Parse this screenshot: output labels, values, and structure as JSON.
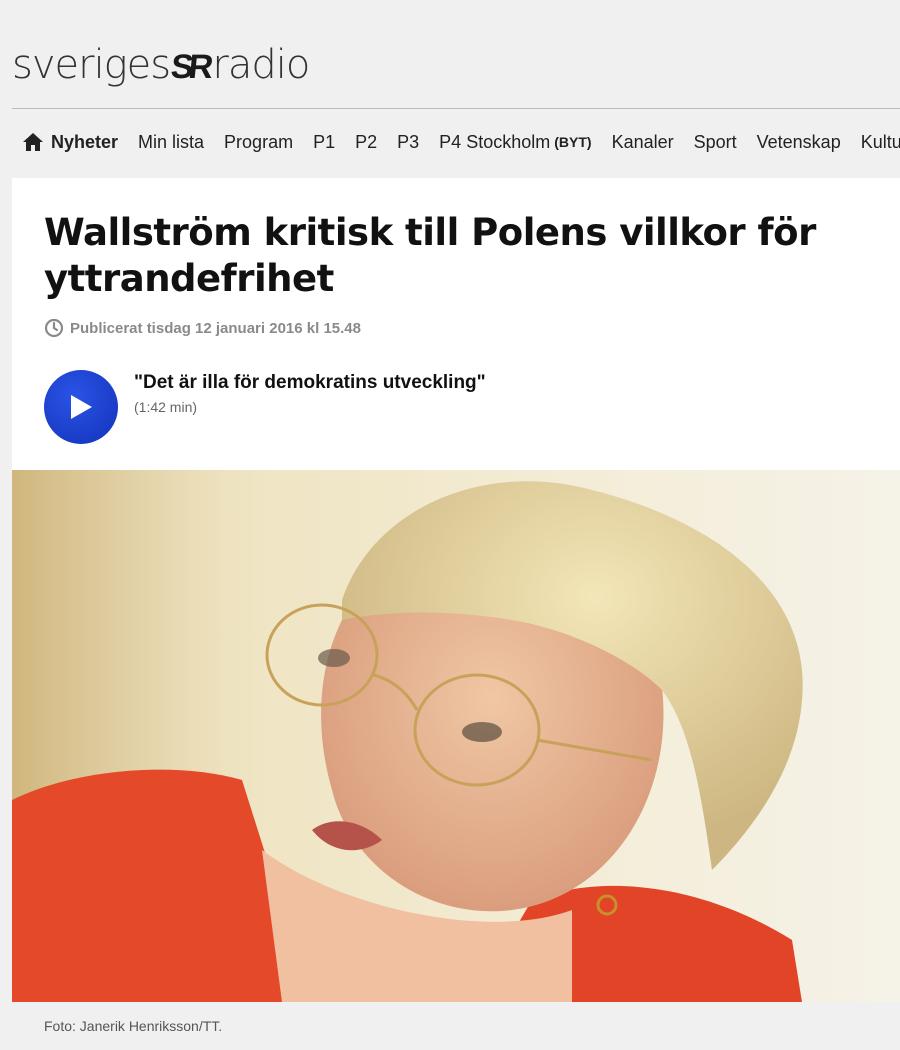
{
  "brand": {
    "logo_left": "sveriges",
    "logo_mark": "SR",
    "logo_right": "radio"
  },
  "nav": {
    "items": [
      "Nyheter",
      "Min lista",
      "Program",
      "P1",
      "P2",
      "P3",
      "P4 Stockholm",
      "Kanaler",
      "Sport",
      "Vetenskap",
      "Kultur"
    ],
    "p4_change": "(BYT)",
    "home_icon": "home-icon"
  },
  "article": {
    "headline": "Wallström kritisk till Polens villkor för yttrandefrihet",
    "published": "Publicerat tisdag 12 januari 2016 kl 15.48",
    "audio": {
      "title": "\"Det är illa för demokratins utveckling\"",
      "duration": "(1:42 min)"
    },
    "photo_caption": "Foto: Janerik Henriksson/TT."
  },
  "colors": {
    "play_button": "#1a3fcf",
    "page_bg": "#f0f0f0"
  }
}
